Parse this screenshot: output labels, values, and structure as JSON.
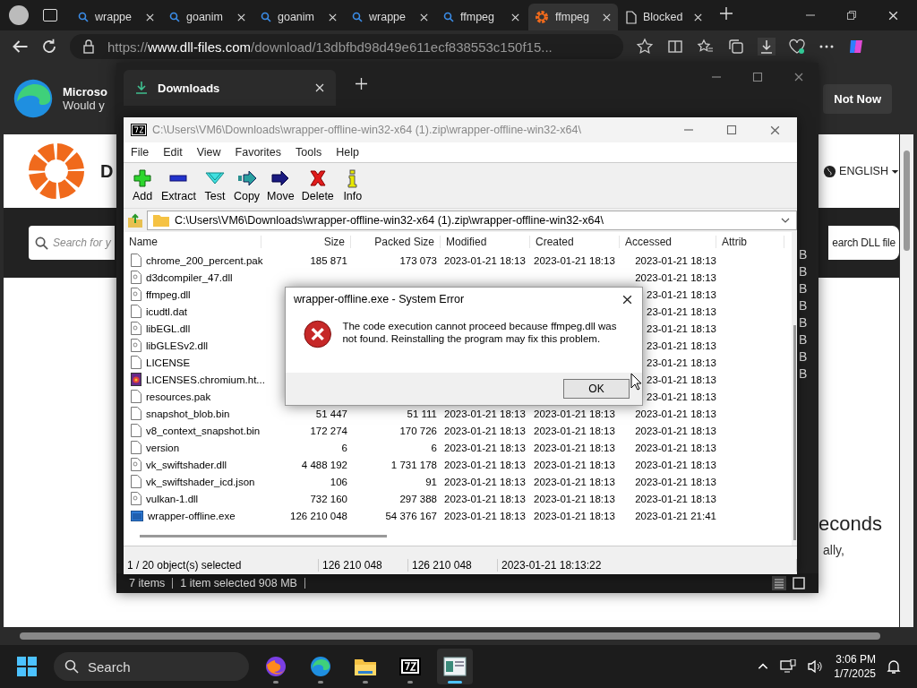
{
  "browser": {
    "tabs": [
      {
        "title": "wrappe",
        "kind": "search",
        "selected": false
      },
      {
        "title": "goanim",
        "kind": "search",
        "selected": false
      },
      {
        "title": "goanim",
        "kind": "search",
        "selected": false
      },
      {
        "title": "wrappe",
        "kind": "search",
        "selected": false
      },
      {
        "title": "ffmpeg",
        "kind": "search",
        "selected": false
      },
      {
        "title": "ffmpeg",
        "kind": "gear",
        "selected": true
      },
      {
        "title": "Blocked",
        "kind": "page",
        "selected": false
      }
    ],
    "url": {
      "scheme": "https://",
      "host": "www.dll-files.com",
      "path": "/download/13dbfbd98d49e611ecf838553c150f15..."
    },
    "banner": {
      "title": "Microso",
      "subtitle": "Would y",
      "button": "Not Now"
    },
    "page": {
      "site_title": "D",
      "language": "ENGLISH",
      "search_placeholder": "Search for y",
      "search_button": "earch DLL file",
      "heading": "econds",
      "text": "ally,"
    }
  },
  "downloads": {
    "title": "Downloads",
    "size_fragments": [
      "B",
      "B",
      "B",
      "B",
      "B",
      "B",
      "B",
      "B"
    ],
    "status": [
      "7 items",
      "1 item selected  908 MB"
    ]
  },
  "sevenzip": {
    "title": "C:\\Users\\VM6\\Downloads\\wrapper-offline-win32-x64 (1).zip\\wrapper-offline-win32-x64\\",
    "menu": [
      "File",
      "Edit",
      "View",
      "Favorites",
      "Tools",
      "Help"
    ],
    "toolbar": [
      {
        "label": "Add",
        "kind": "add"
      },
      {
        "label": "Extract",
        "kind": "extract"
      },
      {
        "label": "Test",
        "kind": "test"
      },
      {
        "label": "Copy",
        "kind": "copy"
      },
      {
        "label": "Move",
        "kind": "move"
      },
      {
        "label": "Delete",
        "kind": "delete"
      },
      {
        "label": "Info",
        "kind": "info"
      }
    ],
    "path": "C:\\Users\\VM6\\Downloads\\wrapper-offline-win32-x64 (1).zip\\wrapper-offline-win32-x64\\",
    "columns": [
      "Name",
      "Size",
      "Packed Size",
      "Modified",
      "Created",
      "Accessed",
      "Attrib"
    ],
    "rows": [
      {
        "kind": "file",
        "name": "chrome_200_percent.pak",
        "size": "185 871",
        "packed": "173 073",
        "modified": "2023-01-21 18:13",
        "created": "2023-01-21 18:13",
        "accessed": "2023-01-21 18:13"
      },
      {
        "kind": "dll",
        "name": "d3dcompiler_47.dll",
        "accessed": "2023-01-21 18:13"
      },
      {
        "kind": "dll",
        "name": "ffmpeg.dll",
        "accessed": "23-01-21 18:13"
      },
      {
        "kind": "file",
        "name": "icudtl.dat",
        "accessed": "23-01-21 18:13"
      },
      {
        "kind": "dll",
        "name": "libEGL.dll",
        "accessed": "23-01-21 18:13"
      },
      {
        "kind": "dll",
        "name": "libGLESv2.dll",
        "accessed": "23-01-21 18:13"
      },
      {
        "kind": "file",
        "name": "LICENSE",
        "accessed": "23-01-21 18:13"
      },
      {
        "kind": "html",
        "name": "LICENSES.chromium.ht...",
        "accessed": "23-01-21 18:13"
      },
      {
        "kind": "file",
        "name": "resources.pak",
        "accessed": "23-01-21 18:13"
      },
      {
        "kind": "file",
        "name": "snapshot_blob.bin",
        "size": "51 447",
        "packed": "51 111",
        "modified": "2023-01-21 18:13",
        "created": "2023-01-21 18:13",
        "accessed": "2023-01-21 18:13"
      },
      {
        "kind": "file",
        "name": "v8_context_snapshot.bin",
        "size": "172 274",
        "packed": "170 726",
        "modified": "2023-01-21 18:13",
        "created": "2023-01-21 18:13",
        "accessed": "2023-01-21 18:13"
      },
      {
        "kind": "file",
        "name": "version",
        "size": "6",
        "packed": "6",
        "modified": "2023-01-21 18:13",
        "created": "2023-01-21 18:13",
        "accessed": "2023-01-21 18:13"
      },
      {
        "kind": "dll",
        "name": "vk_swiftshader.dll",
        "size": "4 488 192",
        "packed": "1 731 178",
        "modified": "2023-01-21 18:13",
        "created": "2023-01-21 18:13",
        "accessed": "2023-01-21 18:13"
      },
      {
        "kind": "file",
        "name": "vk_swiftshader_icd.json",
        "size": "106",
        "packed": "91",
        "modified": "2023-01-21 18:13",
        "created": "2023-01-21 18:13",
        "accessed": "2023-01-21 18:13"
      },
      {
        "kind": "dll",
        "name": "vulkan-1.dll",
        "size": "732 160",
        "packed": "297 388",
        "modified": "2023-01-21 18:13",
        "created": "2023-01-21 18:13",
        "accessed": "2023-01-21 18:13"
      },
      {
        "kind": "exe",
        "name": "wrapper-offline.exe",
        "size": "126 210 048",
        "packed": "54 376 167",
        "modified": "2023-01-21 18:13",
        "created": "2023-01-21 18:13",
        "accessed": "2023-01-21 21:41"
      }
    ],
    "status": [
      "1 / 20 object(s) selected",
      "126 210 048",
      "126 210 048",
      "2023-01-21 18:13:22"
    ]
  },
  "dialog": {
    "title": "wrapper-offline.exe - System Error",
    "message": "The code execution cannot proceed because ffmpeg.dll was not found. Reinstalling the program may fix this problem.",
    "button": "OK"
  },
  "taskbar": {
    "search": "Search",
    "apps": [
      {
        "kind": "firefox",
        "selected": false
      },
      {
        "kind": "edge",
        "selected": false
      },
      {
        "kind": "folder",
        "selected": false
      },
      {
        "kind": "sevenzip",
        "selected": false
      },
      {
        "kind": "window",
        "selected": true
      }
    ],
    "time": "3:06 PM",
    "date": "1/7/2025"
  }
}
